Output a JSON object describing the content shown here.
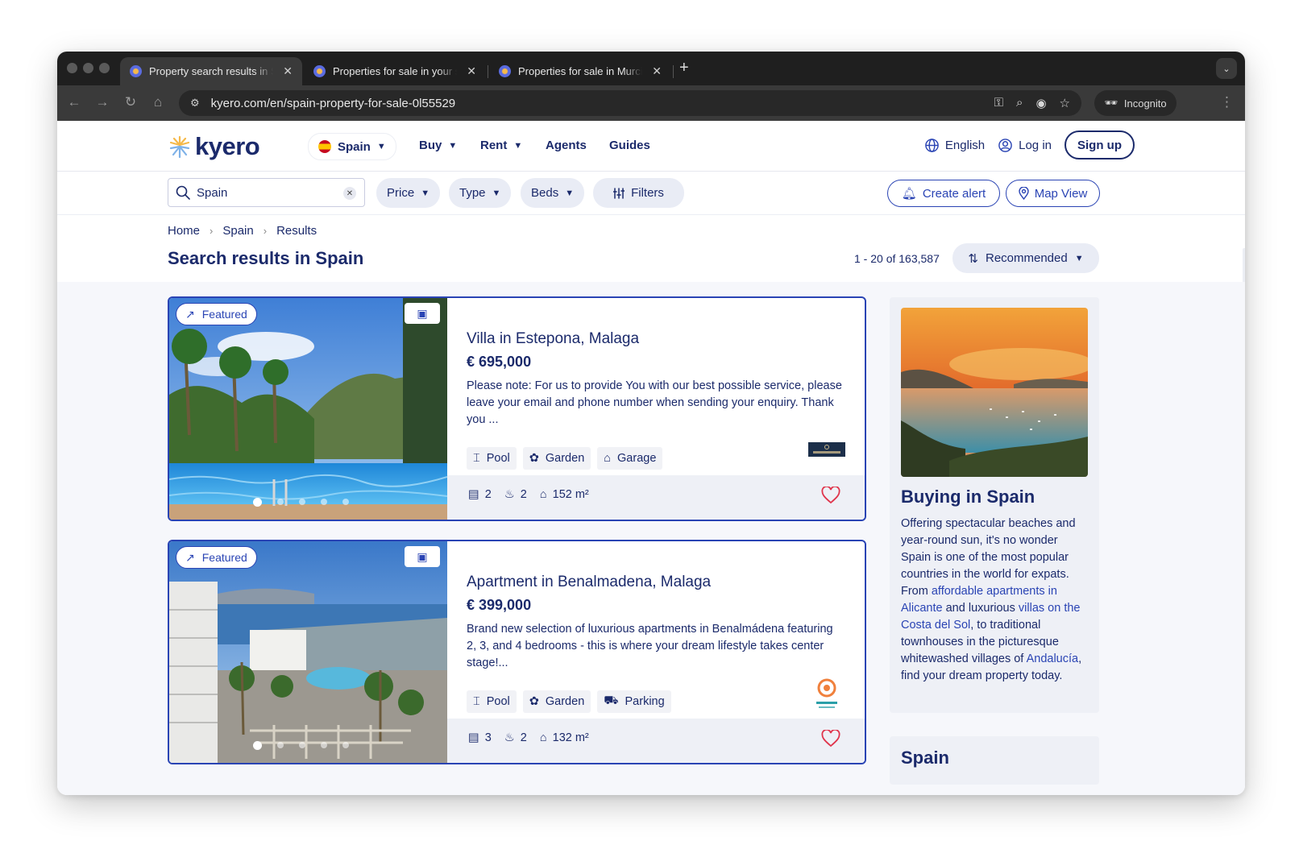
{
  "browser": {
    "tabs": [
      {
        "title": "Property search results in Spain",
        "active": true
      },
      {
        "title": "Properties for sale in your search",
        "active": false
      },
      {
        "title": "Properties for sale in Murcia province",
        "active": false
      }
    ],
    "url": "kyero.com/en/spain-property-for-sale-0l55529",
    "incognito_label": "Incognito"
  },
  "header": {
    "logo_text": "kyero",
    "country": "Spain",
    "nav": [
      "Buy",
      "Rent",
      "Agents",
      "Guides"
    ],
    "language": "English",
    "login": "Log in",
    "signup": "Sign up"
  },
  "filters": {
    "search_value": "Spain",
    "pills": [
      "Price",
      "Type",
      "Beds"
    ],
    "filters_label": "Filters",
    "create_alert": "Create alert",
    "map_view": "Map View"
  },
  "breadcrumb": [
    "Home",
    "Spain",
    "Results"
  ],
  "results": {
    "title": "Search results in Spain",
    "count": "1 - 20 of 163,587",
    "sort": "Recommended"
  },
  "listings": [
    {
      "badge": "Featured",
      "title": "Villa in Estepona, Malaga",
      "price": "€ 695,000",
      "description": "Please note: For us to provide You with our best possible service, please leave your email and phone number when sending your enquiry. Thank you ...",
      "features": [
        "Pool",
        "Garden",
        "Garage"
      ],
      "agent": "CarlingPetri",
      "beds": "2",
      "baths": "2",
      "area": "152 m²"
    },
    {
      "badge": "Featured",
      "title": "Apartment in Benalmadena, Malaga",
      "price": "€ 399,000",
      "description": "Brand new selection of luxurious apartments in Benalmádena featuring 2, 3, and 4 bedrooms - this is where your dream lifestyle takes center stage!...",
      "features": [
        "Pool",
        "Garden",
        "Parking"
      ],
      "agent": "affinity",
      "beds": "3",
      "baths": "2",
      "area": "132 m²"
    }
  ],
  "sidebar": {
    "title": "Buying in Spain",
    "text_1": "Offering spectacular beaches and year-round sun, it's no wonder Spain is one of the most popular countries in the world for expats. From ",
    "link_1": "affordable apartments in Alicante",
    "text_2": " and luxurious ",
    "link_2": "villas on the Costa del Sol",
    "text_3": ", to traditional townhouses in the picturesque whitewashed villages of ",
    "link_3": "Andalucía",
    "text_4": ", find your dream property today.",
    "second_title": "Spain"
  },
  "colors": {
    "brand_navy": "#1b2a6b",
    "accent_blue": "#2a44b4",
    "heart_red": "#e0344b"
  }
}
